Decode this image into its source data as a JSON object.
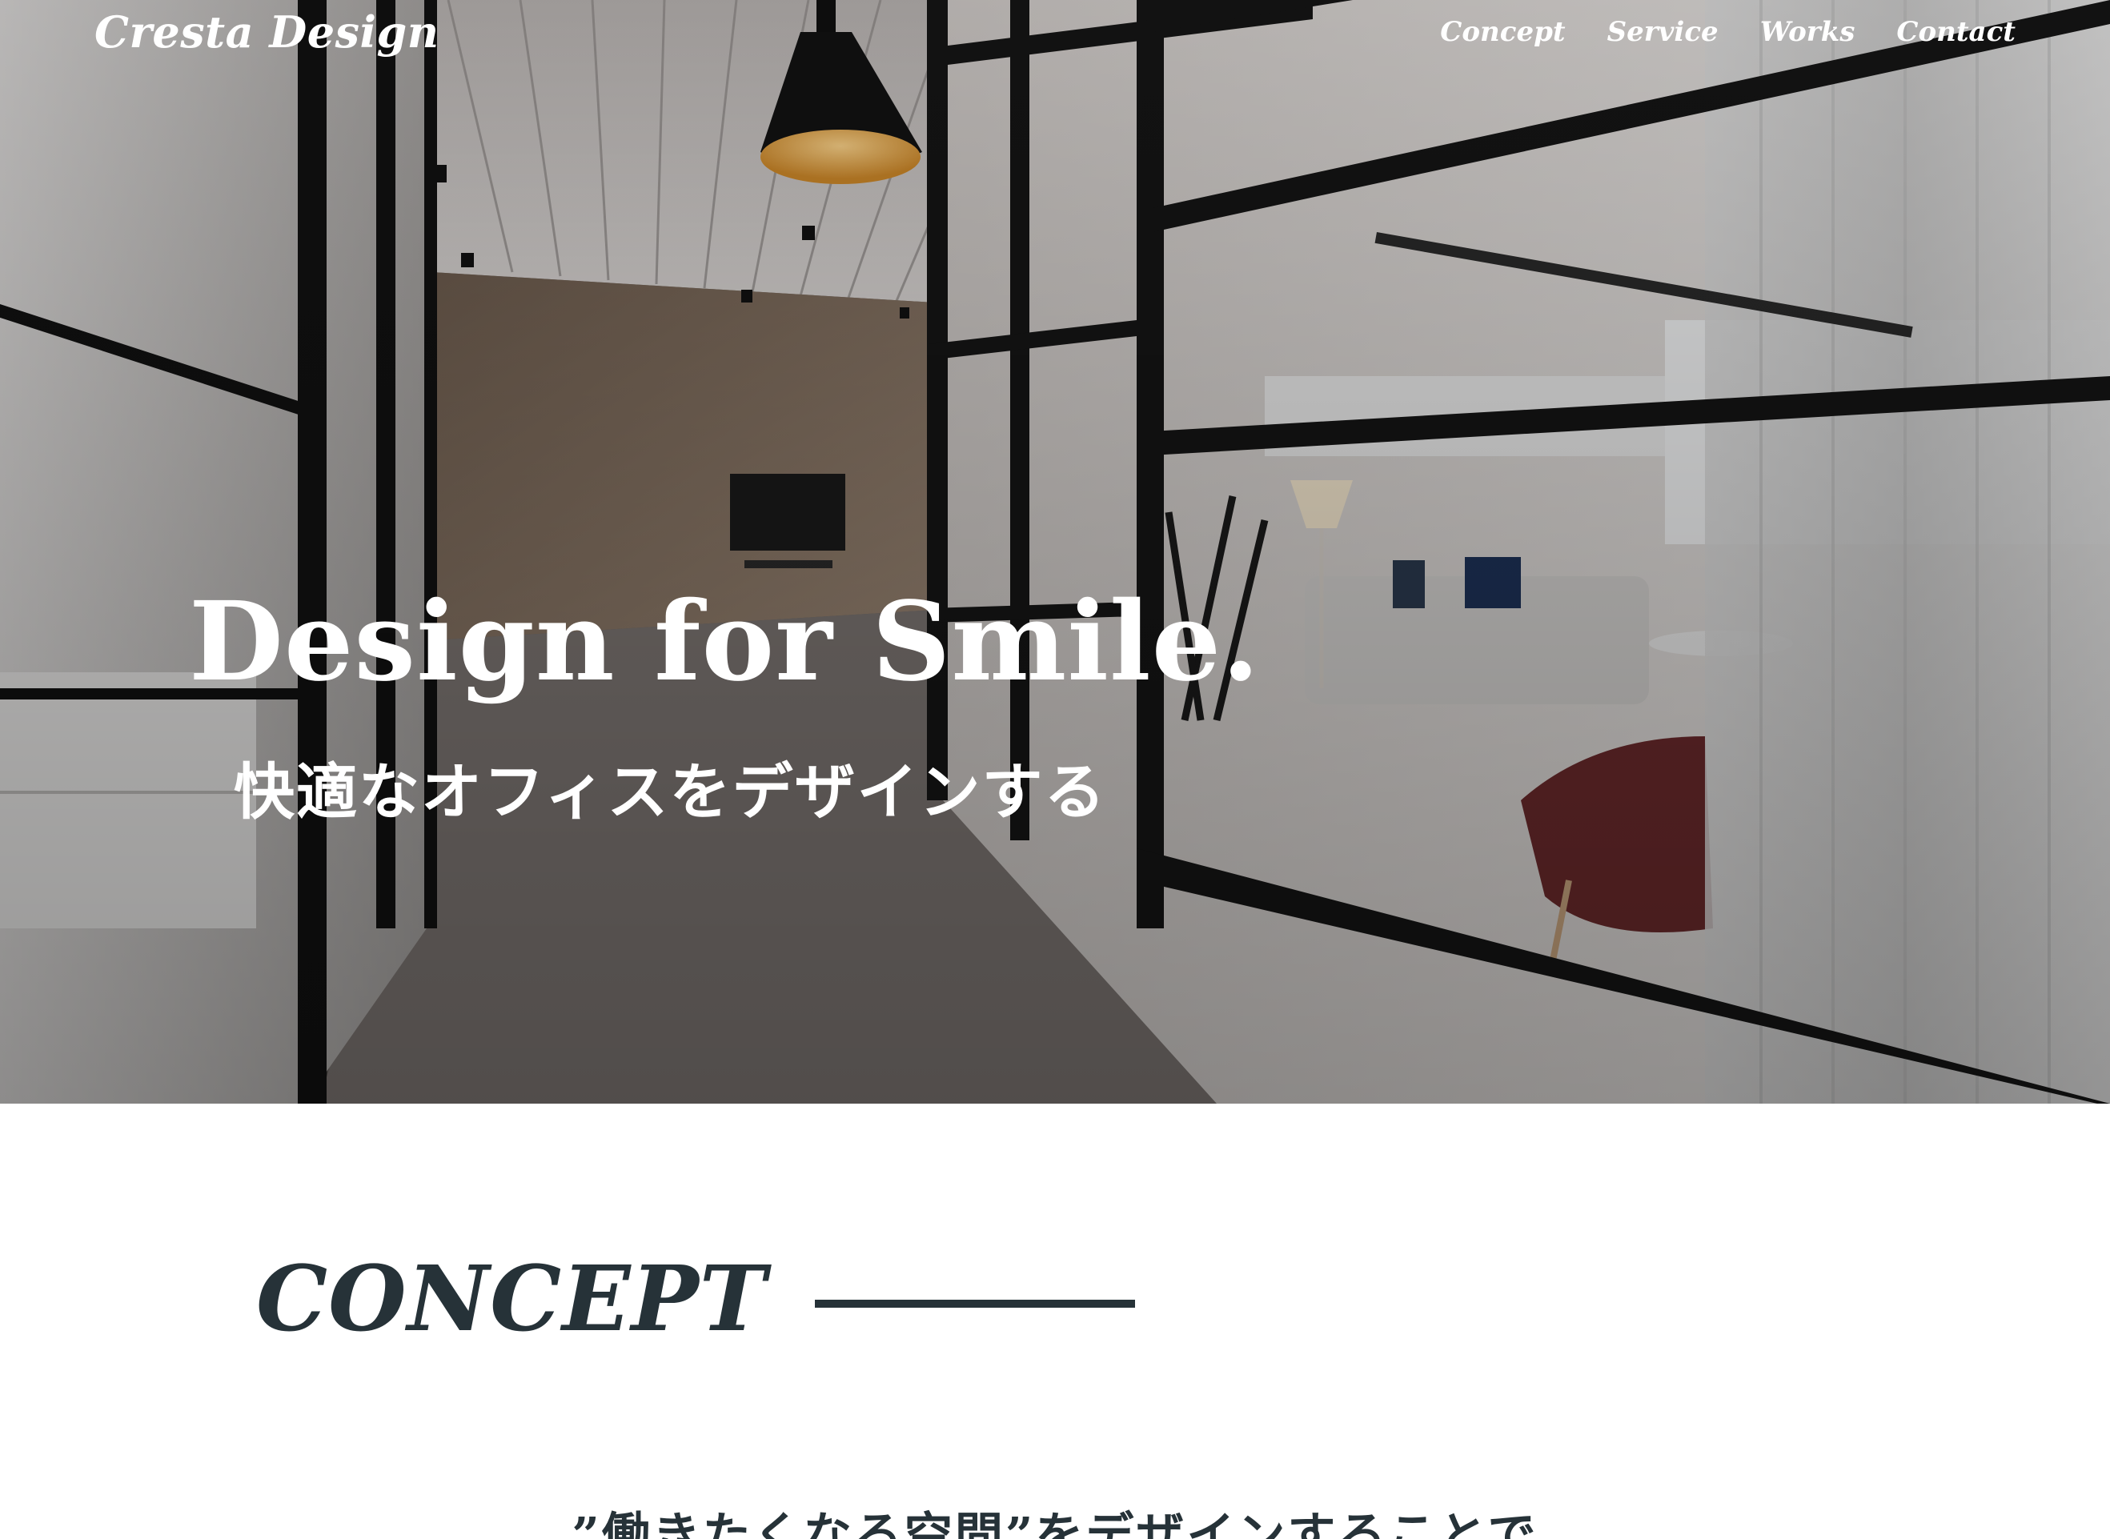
{
  "header": {
    "logo": "Cresta Design",
    "nav": [
      "Concept",
      "Service",
      "Works",
      "Contact"
    ]
  },
  "hero": {
    "title": "Design for Smile.",
    "subtitle": "快適なオフィスをデザインする"
  },
  "concept": {
    "title": "CONCEPT",
    "lead": "”働きたくなる空間”をデザインすることで"
  },
  "colors": {
    "text_dark": "#263238",
    "hero_text": "#ffffff"
  }
}
